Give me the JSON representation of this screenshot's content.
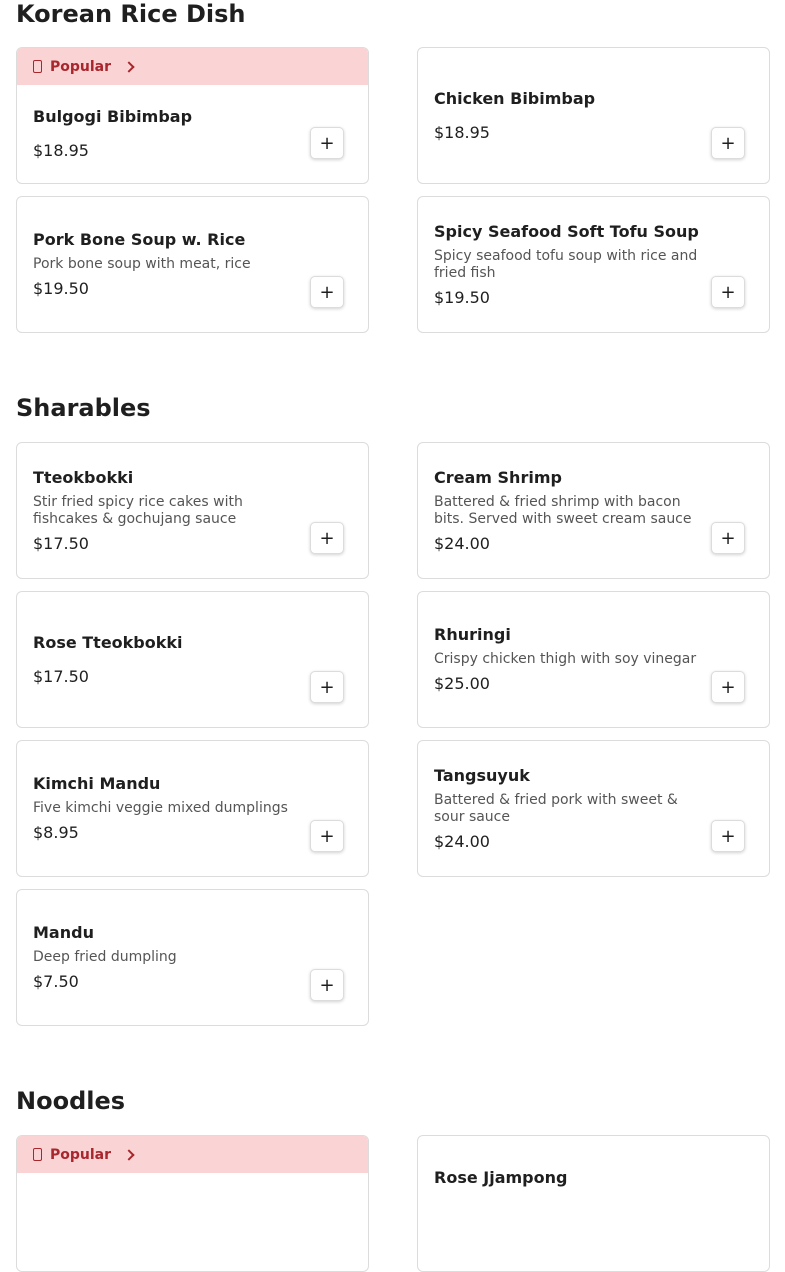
{
  "sections": [
    {
      "title": "Korean Rice Dish",
      "items": [
        {
          "name": "Bulgogi Bibimbap",
          "description": "",
          "price": "$18.95",
          "popular": true
        },
        {
          "name": "Chicken Bibimbap",
          "description": "",
          "price": "$18.95",
          "popular": false
        },
        {
          "name": "Pork Bone Soup w. Rice",
          "description": "Pork bone soup with meat, rice",
          "price": "$19.50",
          "popular": false
        },
        {
          "name": "Spicy Seafood Soft Tofu Soup",
          "description": "Spicy seafood tofu soup with rice and fried fish",
          "price": "$19.50",
          "popular": false
        }
      ]
    },
    {
      "title": "Sharables",
      "items": [
        {
          "name": "Tteokbokki",
          "description": "Stir fried spicy rice cakes with fishcakes & gochujang sauce",
          "price": "$17.50",
          "popular": false
        },
        {
          "name": "Cream Shrimp",
          "description": "Battered & fried shrimp with bacon bits. Served with sweet cream sauce",
          "price": "$24.00",
          "popular": false
        },
        {
          "name": "Rose Tteokbokki",
          "description": "",
          "price": "$17.50",
          "popular": false
        },
        {
          "name": "Rhuringi",
          "description": "Crispy chicken thigh with soy vinegar",
          "price": "$25.00",
          "popular": false
        },
        {
          "name": "Kimchi Mandu",
          "description": "Five kimchi veggie mixed dumplings",
          "price": "$8.95",
          "popular": false
        },
        {
          "name": "Tangsuyuk",
          "description": "Battered & fried pork with sweet & sour sauce",
          "price": "$24.00",
          "popular": false
        },
        {
          "name": "Mandu",
          "description": "Deep fried dumpling",
          "price": "$7.50",
          "popular": false
        }
      ]
    },
    {
      "title": "Noodles",
      "items": [
        {
          "name": "",
          "description": "",
          "price": "",
          "popular": true
        },
        {
          "name": "Rose Jjampong",
          "description": "",
          "price": "",
          "popular": false
        }
      ]
    }
  ],
  "popular_label": "Popular",
  "add_label": "+",
  "icons": {
    "popular": "popular-icon",
    "chevron": "chevron-right-icon"
  },
  "colors": {
    "popular_bg": "#fad4d4",
    "popular_text": "#a8262d"
  }
}
